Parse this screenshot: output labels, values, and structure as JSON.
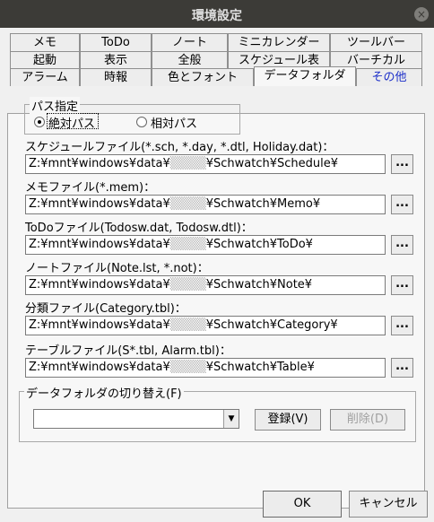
{
  "window": {
    "title": "環境設定",
    "close_glyph": "×"
  },
  "tabs": {
    "row1": [
      "メモ",
      "ToDo",
      "ノート",
      "ミニカレンダー",
      "ツールバー"
    ],
    "row2": [
      "起動",
      "表示",
      "全般",
      "スケジュール表",
      "バーチカル"
    ],
    "row3": [
      "アラーム",
      "時報",
      "色とフォント",
      "データフォルダ",
      "その他"
    ],
    "active": "データフォルダ"
  },
  "path_mode": {
    "group_label": "パス指定",
    "absolute_label": "絶対パス",
    "relative_label": "相対パス",
    "selected": "absolute"
  },
  "folders": [
    {
      "label": "スケジュールファイル(*.sch, *.day, *.dtl, Holiday.dat)：",
      "prefix": "Z:¥mnt¥windows¥data¥",
      "suffix": "¥Schwatch¥Schedule¥"
    },
    {
      "label": "メモファイル(*.mem)：",
      "prefix": "Z:¥mnt¥windows¥data¥",
      "suffix": "¥Schwatch¥Memo¥"
    },
    {
      "label": "ToDoファイル(Todosw.dat, Todosw.dtl)：",
      "prefix": "Z:¥mnt¥windows¥data¥",
      "suffix": "¥Schwatch¥ToDo¥"
    },
    {
      "label": "ノートファイル(Note.lst, *.not)：",
      "prefix": "Z:¥mnt¥windows¥data¥",
      "suffix": "¥Schwatch¥Note¥"
    },
    {
      "label": "分類ファイル(Category.tbl)：",
      "prefix": "Z:¥mnt¥windows¥data¥",
      "suffix": "¥Schwatch¥Category¥"
    },
    {
      "label": "テーブルファイル(S*.tbl, Alarm.tbl)：",
      "prefix": "Z:¥mnt¥windows¥data¥",
      "suffix": "¥Schwatch¥Table¥"
    }
  ],
  "browse_label": "...",
  "switcher": {
    "group_label": "データフォルダの切り替え(F)",
    "combo_value": "",
    "combo_arrow": "▼",
    "register_label": "登録(V)",
    "delete_label": "削除(D)"
  },
  "footer": {
    "ok_label": "OK",
    "cancel_label": "キャンセル"
  },
  "colors": {
    "titlebar": "#3c3b37",
    "selected_tab_text": "#1c2fc9",
    "panel": "#f7f7f7"
  }
}
